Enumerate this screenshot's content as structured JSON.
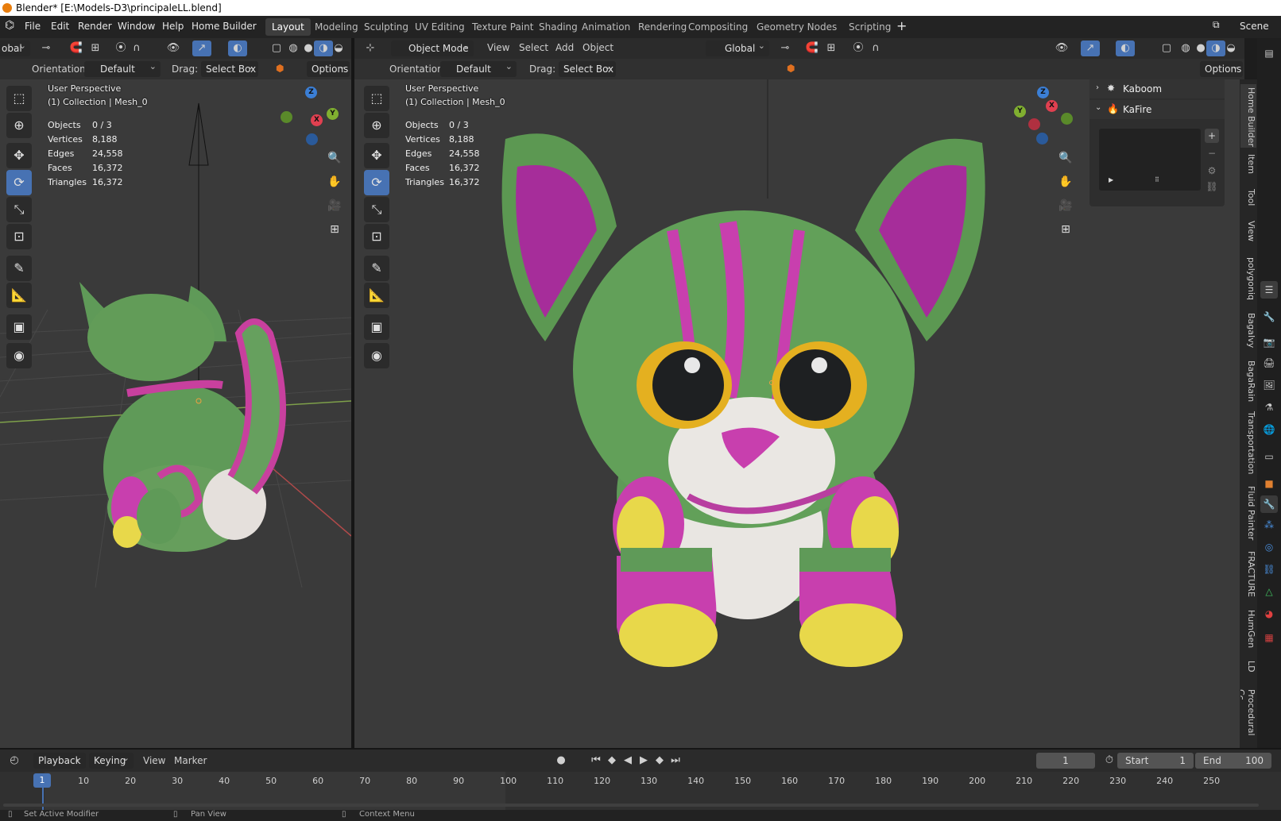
{
  "window": {
    "title": "Blender* [E:\\Models-D3\\principaleLL.blend]"
  },
  "menu": {
    "file": "File",
    "edit": "Edit",
    "render": "Render",
    "window": "Window",
    "help": "Help",
    "home_builder": "Home Builder"
  },
  "workspaces": [
    "Layout",
    "Modeling",
    "Sculpting",
    "UV Editing",
    "Texture Paint",
    "Shading",
    "Animation",
    "Rendering",
    "Compositing",
    "Geometry Nodes",
    "Scripting"
  ],
  "active_workspace": "Layout",
  "scene_name": "Scene",
  "left_viewport": {
    "header": {
      "global_label": "obal",
      "orientation_label": "Orientation:",
      "orientation_value": "Default",
      "drag_label": "Drag:",
      "drag_value": "Select Box",
      "options": "Options"
    },
    "perspective": "User Perspective",
    "collection": "(1) Collection | Mesh_0"
  },
  "right_viewport": {
    "header": {
      "mode": "Object Mode",
      "view": "View",
      "select": "Select",
      "add": "Add",
      "object": "Object",
      "transform": "Global",
      "orientation_label": "Orientation:",
      "orientation_value": "Default",
      "drag_label": "Drag:",
      "drag_value": "Select Box",
      "options": "Options"
    },
    "perspective": "User Perspective",
    "collection": "(1) Collection | Mesh_0"
  },
  "stats": {
    "objects_label": "Objects",
    "objects": "0 / 3",
    "vertices_label": "Vertices",
    "vertices": "8,188",
    "edges_label": "Edges",
    "edges": "24,558",
    "faces_label": "Faces",
    "faces": "16,372",
    "triangles_label": "Triangles",
    "triangles": "16,372"
  },
  "gizmo": {
    "x": "X",
    "y": "Y",
    "z": "Z"
  },
  "sidebar_panels": [
    "Kaboom",
    "KaFire"
  ],
  "sidebar_tabs": [
    "Home Builder",
    "Item",
    "Tool",
    "View",
    "polygoniq",
    "BagaIvy",
    "BagaRain",
    "Transportation",
    "Fluid Painter",
    "FRACTURE",
    "HumGen",
    "LD",
    "Procedural Cc"
  ],
  "timeline": {
    "menus": [
      "Playback",
      "Keying",
      "View",
      "Marker"
    ],
    "current_frame": "1",
    "start_label": "Start",
    "start": "1",
    "end_label": "End",
    "end": "100",
    "ticks": [
      "1",
      "10",
      "20",
      "30",
      "40",
      "50",
      "60",
      "70",
      "80",
      "90",
      "100",
      "110",
      "120",
      "130",
      "140",
      "150",
      "160",
      "170",
      "180",
      "190",
      "200",
      "210",
      "220",
      "230",
      "240",
      "250"
    ]
  },
  "status": {
    "left": "Set Active Modifier",
    "middle": "Pan View",
    "right": "Context Menu"
  },
  "colors": {
    "accent": "#4772b3",
    "header": "#2b2b2b",
    "viewport": "#3a3a3a",
    "cat_green": "#5f9a58",
    "cat_pink": "#c83fae",
    "cat_yellow": "#e8d84a"
  }
}
